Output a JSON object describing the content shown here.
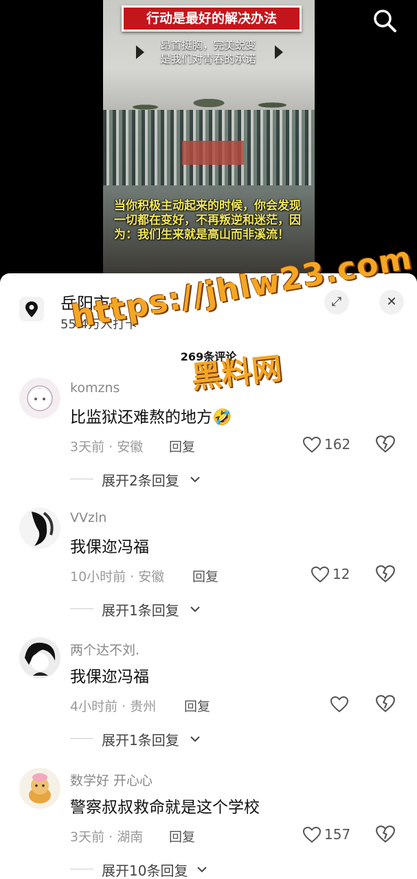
{
  "video": {
    "banner": "行动是最好的解决办法",
    "subtitle_line1": "昂首挺胸，完美蜕变",
    "subtitle_line2": "是我们对青春的承诺",
    "caption": "当你积极主动起来的时候，你会发现一切都在变好，不再叛逆和迷茫，因为：我们生来就是高山而非溪流！"
  },
  "search": {
    "icon": "search-icon"
  },
  "location": {
    "title": "岳阳市",
    "subtitle": "55.4万人打卡"
  },
  "comments_count": "269条评论",
  "comments": [
    {
      "user": "komzns",
      "text": "比监狱还难熬的地方🤣",
      "meta": "3天前 · 安徽",
      "reply": "回复",
      "likes": "162",
      "expand": "展开2条回复"
    },
    {
      "user": "VVzln",
      "text": "我倮迩冯福",
      "meta": "10小时前 · 安徽",
      "reply": "回复",
      "likes": "12",
      "expand": "展开1条回复"
    },
    {
      "user": "两个达不刘.",
      "text": "我倮迩冯福",
      "meta": "4小时前 · 贵州",
      "reply": "回复",
      "likes": "",
      "expand": "展开1条回复"
    },
    {
      "user": "数学好 开心心",
      "text": "警察叔叔救命就是这个学校",
      "meta": "3天前 · 湖南",
      "reply": "回复",
      "likes": "157",
      "expand": "展开10条回复"
    }
  ],
  "watermark": {
    "line1": "https://jhlw23.com",
    "line2": "黑料网"
  },
  "colors": {
    "banner_red": "#c3161c",
    "caption_yellow": "#f3e85a",
    "watermark_orange": "#f5a623"
  }
}
